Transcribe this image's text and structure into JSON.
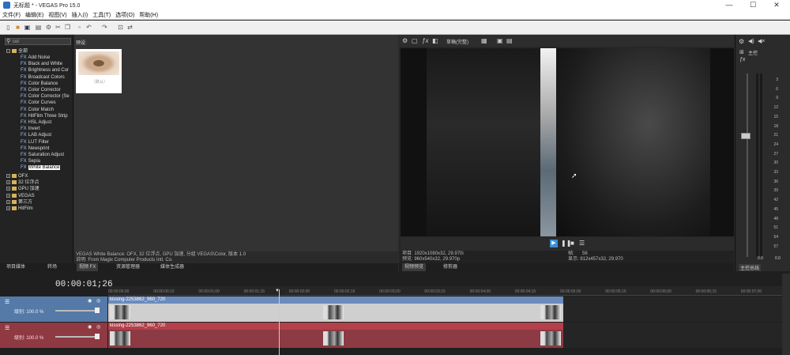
{
  "window": {
    "title": "无标题 * - VEGAS Pro 15.0",
    "minimize": "—",
    "maximize": "☐",
    "close": "✕"
  },
  "menu": [
    "文件(F)",
    "编辑(E)",
    "视图(V)",
    "插入(I)",
    "工具(T)",
    "选项(O)",
    "帮助(H)"
  ],
  "explorer": {
    "search_value": "col",
    "tree_root": "全部",
    "fx_items": [
      "Add Noise",
      "Black and White",
      "Brightness and Cor",
      "Broadcast Colors",
      "Color Balance",
      "Color Corrector",
      "Color Corrector (Se",
      "Color Curves",
      "Color Match",
      "HitFilm Three Strip",
      "HSL Adjust",
      "Invert",
      "LAB Adjust",
      "LUT Filter",
      "Newsprint",
      "Saturation Adjust",
      "Sepia",
      "White Balance"
    ],
    "fx_prefix": "FX",
    "groups": [
      "OFX",
      "32 位浮点",
      "GPU 加速",
      "VEGAS",
      "第三方",
      "HitFilm"
    ]
  },
  "presets": {
    "label": "预设:",
    "thumb_caption": "（默认）"
  },
  "status1": {
    "line1": "VEGAS White Balance: OFX, 32 位浮点, GPU 加速, 分组 VEGAS\\Color, 版本 1.0",
    "line2": "说明: From Magix Computer Products Intl. Co."
  },
  "tabs_left": [
    "项目媒体",
    "转场",
    "视频 FX",
    "资源管理器",
    "媒体生成器"
  ],
  "preview": {
    "quality": "草稿(完整)",
    "project_info": "项目: 1920x1080x32, 29.970i",
    "preview_info": "预览: 960x540x32, 29.970p",
    "frame_label": "帧:",
    "frame_value": "56",
    "display_label": "显示: 812x457x32, 29.970"
  },
  "tabs_preview": [
    "视频预览",
    "修剪器"
  ],
  "master": {
    "label": "主控",
    "ticks": [
      "3",
      "6",
      "9",
      "12",
      "15",
      "18",
      "21",
      "24",
      "27",
      "30",
      "33",
      "36",
      "39",
      "42",
      "45",
      "48",
      "51",
      "54",
      "57"
    ],
    "bottom_left": "0.0",
    "bottom_right": "0.0",
    "tab": "主控总线"
  },
  "timeline": {
    "timecode": "00:00:01;26",
    "ruler": [
      "00:00:00;00",
      "00:00:00;15",
      "00:00:01;00",
      "00:00:01;15",
      "00:00:02;00",
      "00:00:02;15",
      "00:00:03;00",
      "00:00:03;15",
      "00:00:04;00",
      "00:00:04;15",
      "00:00:05;00",
      "00:00:05;15",
      "00:00:06;00",
      "00:00:06;15",
      "00:00:07;00"
    ],
    "tracks": [
      {
        "level_label": "级别: 100.0 %",
        "clip_name": "kissing-2253862_960_720",
        "color": "#6b8bbd",
        "body": "#cfcfcf"
      },
      {
        "level_label": "级别: 100.0 %",
        "clip_name": "kissing-2253862_960_720",
        "color": "#b3404a",
        "body": "#8c3a43"
      }
    ]
  }
}
